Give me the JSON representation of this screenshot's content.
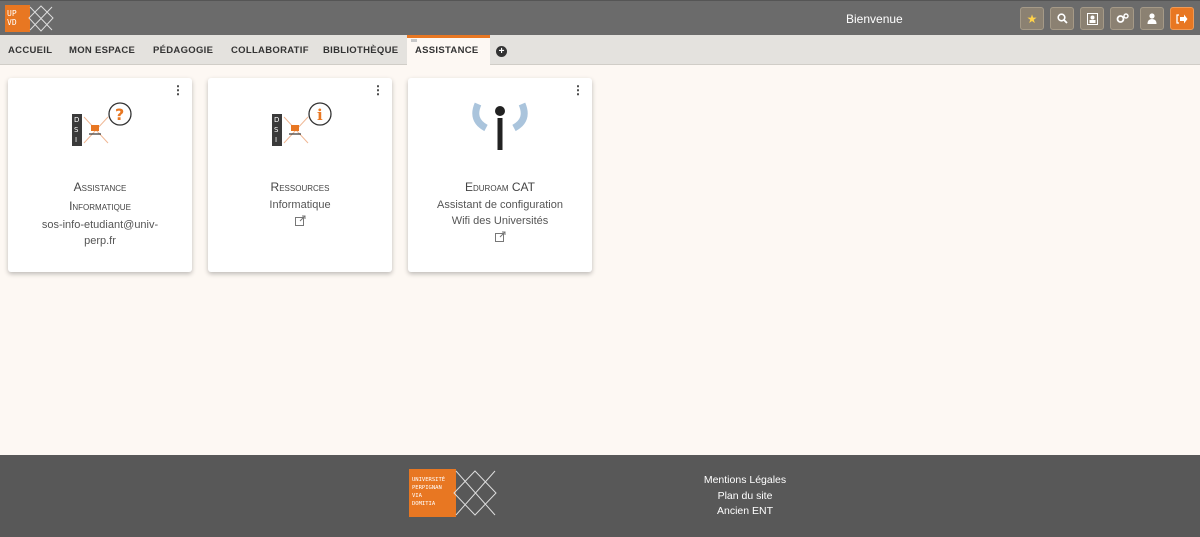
{
  "header": {
    "logo_text_top": "UP",
    "logo_text_bottom": "VD",
    "welcome": "Bienvenue",
    "icons": [
      "star-icon",
      "search-icon",
      "contacts-icon",
      "settings-icon",
      "user-icon",
      "logout-icon"
    ]
  },
  "nav": {
    "items": [
      {
        "label": "ACCUEIL"
      },
      {
        "label": "MON ESPACE"
      },
      {
        "label": "PÉDAGOGIE"
      },
      {
        "label": "COLLABORATIF"
      },
      {
        "label": "BIBLIOTHÈQUE"
      },
      {
        "label": "ASSISTANCE"
      }
    ],
    "active": "ASSISTANCE",
    "add_label": "+"
  },
  "cards": [
    {
      "title_1": "Assistance",
      "title_2": "Informatique",
      "sub_1": "sos-info-etudiant@univ-",
      "sub_2": "perp.fr",
      "icon": "dsi-help-icon"
    },
    {
      "title_1": "Ressources",
      "sub_1": "Informatique",
      "icon": "dsi-info-icon",
      "external": true
    },
    {
      "title_1": "Eduroam CAT",
      "sub_1": "Assistant de configuration",
      "sub_2": "Wifi des Universités",
      "icon": "eduroam-icon",
      "external": true
    }
  ],
  "footer": {
    "logo_lines": [
      "UNIVERSITÉ",
      "PERPIGNAN",
      "VIA",
      "DOMITIA"
    ],
    "links": [
      "Mentions Légales",
      "Plan du site",
      "Ancien ENT"
    ]
  },
  "colors": {
    "accent": "#e87722",
    "topbar": "#6b6b6b",
    "footer": "#585858",
    "background": "#fdf8f3"
  }
}
